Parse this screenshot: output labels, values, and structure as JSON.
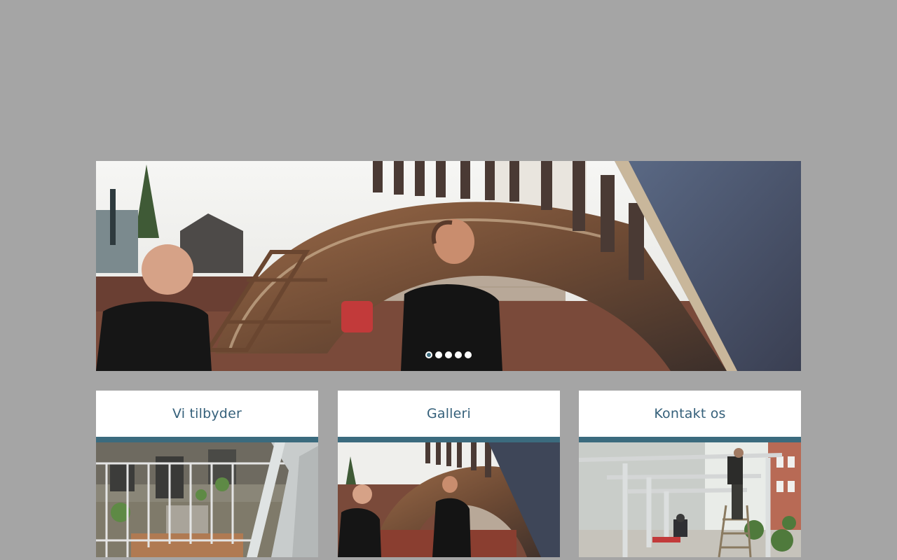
{
  "slider": {
    "slide_count": 5,
    "active_slide": 1
  },
  "cards": [
    {
      "title": "Vi tilbyder",
      "image": "balcony-railing-photo"
    },
    {
      "title": "Galleri",
      "image": "steel-arch-workers-photo"
    },
    {
      "title": "Kontakt os",
      "image": "pergola-construction-photo"
    }
  ],
  "colors": {
    "page_background": "#a5a5a5",
    "accent": "#3b6b7e",
    "card_title": "#35607a"
  }
}
